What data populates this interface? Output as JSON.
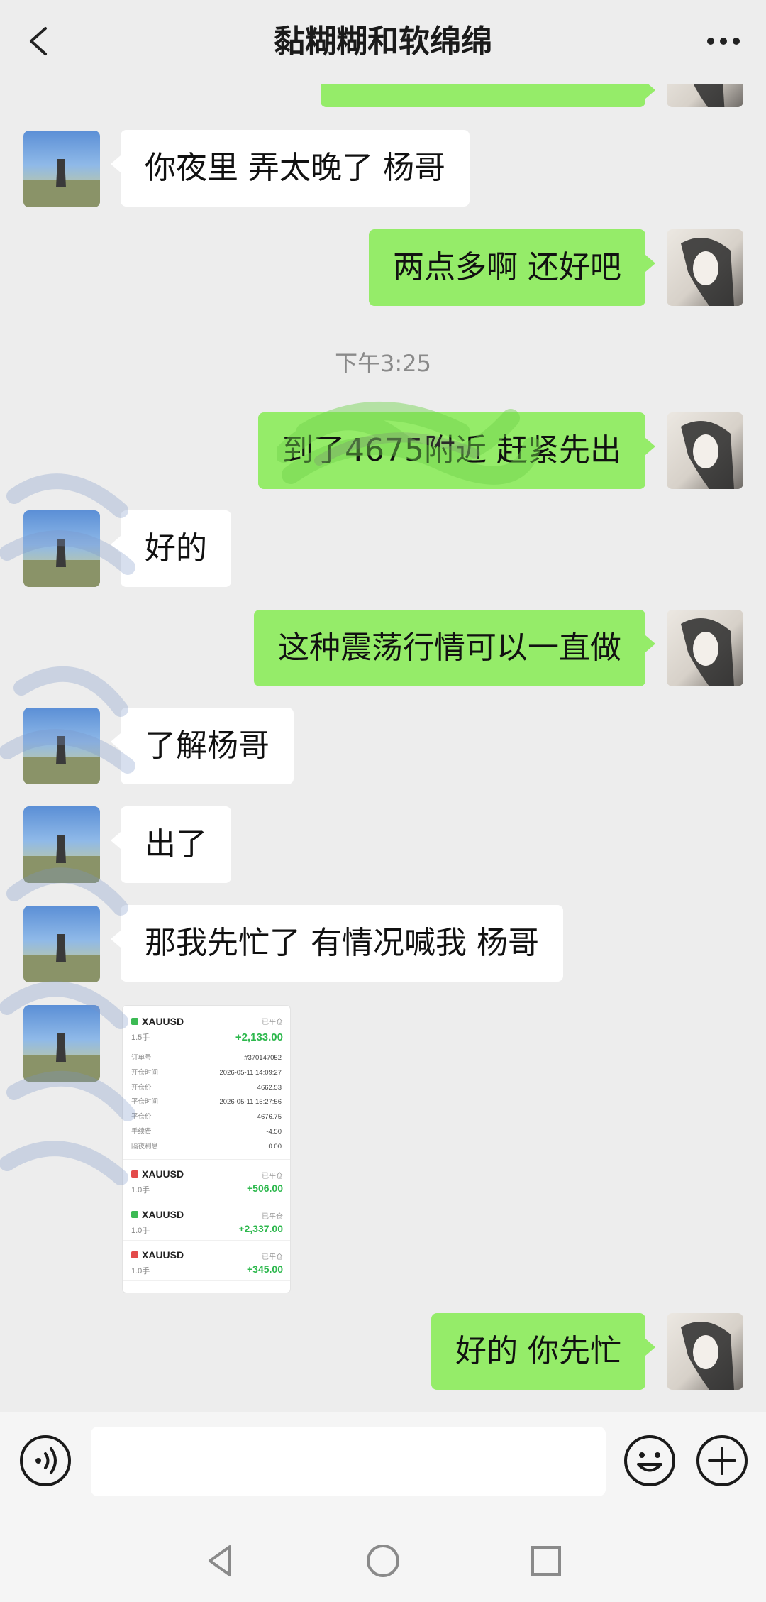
{
  "header": {
    "title": "黏糊糊和软绵绵"
  },
  "messages": [
    {
      "from": "in",
      "text": "你夜里 弄太晚了 杨哥"
    },
    {
      "from": "out",
      "text": "两点多啊  还好吧"
    },
    {
      "from": "out",
      "text": "到了4675附近  赶紧先出"
    },
    {
      "from": "in",
      "text": "好的"
    },
    {
      "from": "out",
      "text": "这种震荡行情可以一直做"
    },
    {
      "from": "in",
      "text": "了解杨哥"
    },
    {
      "from": "in",
      "text": "出了"
    },
    {
      "from": "in",
      "text": "那我先忙了  有情况喊我  杨哥"
    },
    {
      "from": "out",
      "text": "好的  你先忙"
    }
  ],
  "timestamp": "下午3:25",
  "trade_screenshot": {
    "first": {
      "symbol": "XAUUSD",
      "lots": "1.5手",
      "status": "已平仓",
      "profit": "+2,133.00",
      "status_color": "#3cba54",
      "details": [
        {
          "label": "订单号",
          "value": "#370147052"
        },
        {
          "label": "开仓时间",
          "value": "2026-05-11 14:09:27"
        },
        {
          "label": "开仓价",
          "value": "4662.53"
        },
        {
          "label": "平仓时间",
          "value": "2026-05-11 15:27:56"
        },
        {
          "label": "平仓价",
          "value": "4676.75"
        },
        {
          "label": "手续费",
          "value": "-4.50"
        },
        {
          "label": "隔夜利息",
          "value": "0.00"
        }
      ]
    },
    "orders": [
      {
        "symbol": "XAUUSD",
        "lots": "1.0手",
        "status": "已平仓",
        "profit": "+506.00",
        "dot_color": "#e34b4b"
      },
      {
        "symbol": "XAUUSD",
        "lots": "1.0手",
        "status": "已平仓",
        "profit": "+2,337.00",
        "dot_color": "#3cba54"
      },
      {
        "symbol": "XAUUSD",
        "lots": "1.0手",
        "status": "已平仓",
        "profit": "+345.00",
        "dot_color": "#e34b4b"
      }
    ]
  },
  "input": {
    "placeholder": ""
  },
  "icons": {
    "back": "chevron-left-icon",
    "more": "more-dots-icon",
    "voice": "voice-icon",
    "emoji": "emoji-icon",
    "plus": "plus-icon"
  },
  "colors": {
    "background": "#ededed",
    "outgoing_bubble": "#95ec69",
    "incoming_bubble": "#ffffff",
    "profit_green": "#2db84d"
  }
}
